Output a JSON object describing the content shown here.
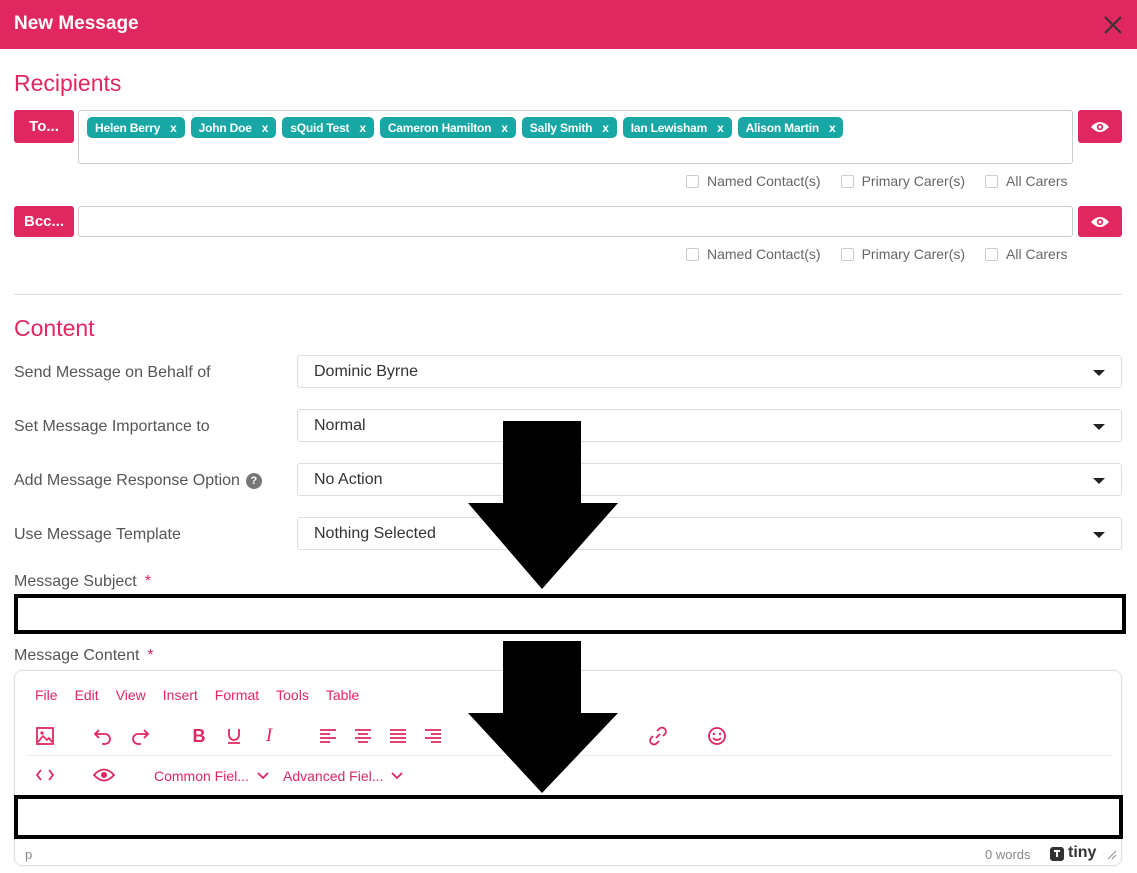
{
  "header": {
    "title": "New Message"
  },
  "recipients": {
    "heading": "Recipients",
    "to_label": "To...",
    "bcc_label": "Bcc...",
    "to_chips": [
      {
        "name": "Helen Berry",
        "x": "x"
      },
      {
        "name": "John Doe",
        "x": "x"
      },
      {
        "name": "sQuid Test",
        "x": "x"
      },
      {
        "name": "Cameron Hamilton",
        "x": "x"
      },
      {
        "name": "Sally Smith",
        "x": "x"
      },
      {
        "name": "Ian Lewisham",
        "x": "x"
      },
      {
        "name": "Alison Martin",
        "x": "x"
      }
    ],
    "options": {
      "named_contacts": "Named Contact(s)",
      "primary_carers": "Primary Carer(s)",
      "all_carers": "All Carers"
    }
  },
  "content": {
    "heading": "Content",
    "behalf_label": "Send Message on Behalf of",
    "behalf_value": "Dominic Byrne",
    "importance_label": "Set Message Importance to",
    "importance_value": "Normal",
    "response_label": "Add Message Response Option",
    "response_help": "?",
    "response_value": "No Action",
    "template_label": "Use Message Template",
    "template_value": "Nothing Selected",
    "subject_label": "Message Subject",
    "content_label": "Message Content",
    "required_mark": "*"
  },
  "editor": {
    "menu": [
      "File",
      "Edit",
      "View",
      "Insert",
      "Format",
      "Tools",
      "Table"
    ],
    "common_fields": "Common Fiel...",
    "advanced_fields": "Advanced Fiel...",
    "status_element": "p",
    "word_count": "0 words",
    "brand": "tiny"
  },
  "colors": {
    "accent": "#e0275f",
    "chip": "#17a7a4"
  }
}
